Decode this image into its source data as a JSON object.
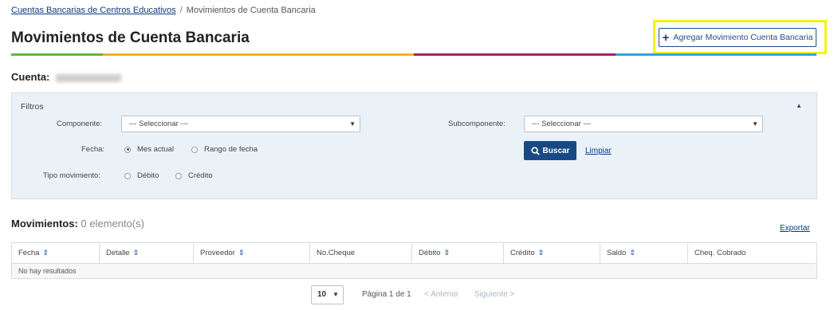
{
  "breadcrumb": {
    "parent": "Cuentas Bancarias de Centros Educativos",
    "separator": "/",
    "current": "Movimientos de Cuenta Bancaria"
  },
  "page_title": "Movimientos de Cuenta Bancaria",
  "add_button": {
    "icon": "plus-icon",
    "label": "Agregar Movimiento Cuenta Bancaria"
  },
  "accent_colors": [
    "#64b346",
    "#f0b321",
    "#b01e5c",
    "#2ea5df"
  ],
  "highlight_color": "#f3f31c",
  "cuenta": {
    "label": "Cuenta:"
  },
  "filters": {
    "title": "Filtros",
    "collapse_icon": "chevron-up-icon",
    "componente": {
      "label": "Componente:",
      "value": "--- Seleccionar ---"
    },
    "subcomponente": {
      "label": "Subcomponente:",
      "value": "--- Seleccionar ---"
    },
    "fecha": {
      "label": "Fecha:",
      "options": [
        "Mes actual",
        "Rango de fecha"
      ],
      "selected": "Mes actual"
    },
    "tipo": {
      "label": "Tipo movimiento:",
      "options": [
        "Débito",
        "Crédito"
      ],
      "selected": ""
    },
    "search_button": {
      "icon": "search-icon",
      "label": "Buscar"
    },
    "clear_link": "Limpiar"
  },
  "movimientos": {
    "title": "Movimientos:",
    "count": "0 elemento(s)"
  },
  "export_link": "Exportar",
  "table": {
    "columns": [
      "Fecha",
      "Detalle",
      "Proveedor",
      "No.Cheque",
      "Débito",
      "Crédito",
      "Saldo",
      "Cheq. Cobrado"
    ],
    "empty_text": "No hay resultados"
  },
  "pagination": {
    "page_size": "10",
    "page_info": "Página 1 de 1",
    "prev": "< Anterior",
    "next": "Siguiente >"
  }
}
